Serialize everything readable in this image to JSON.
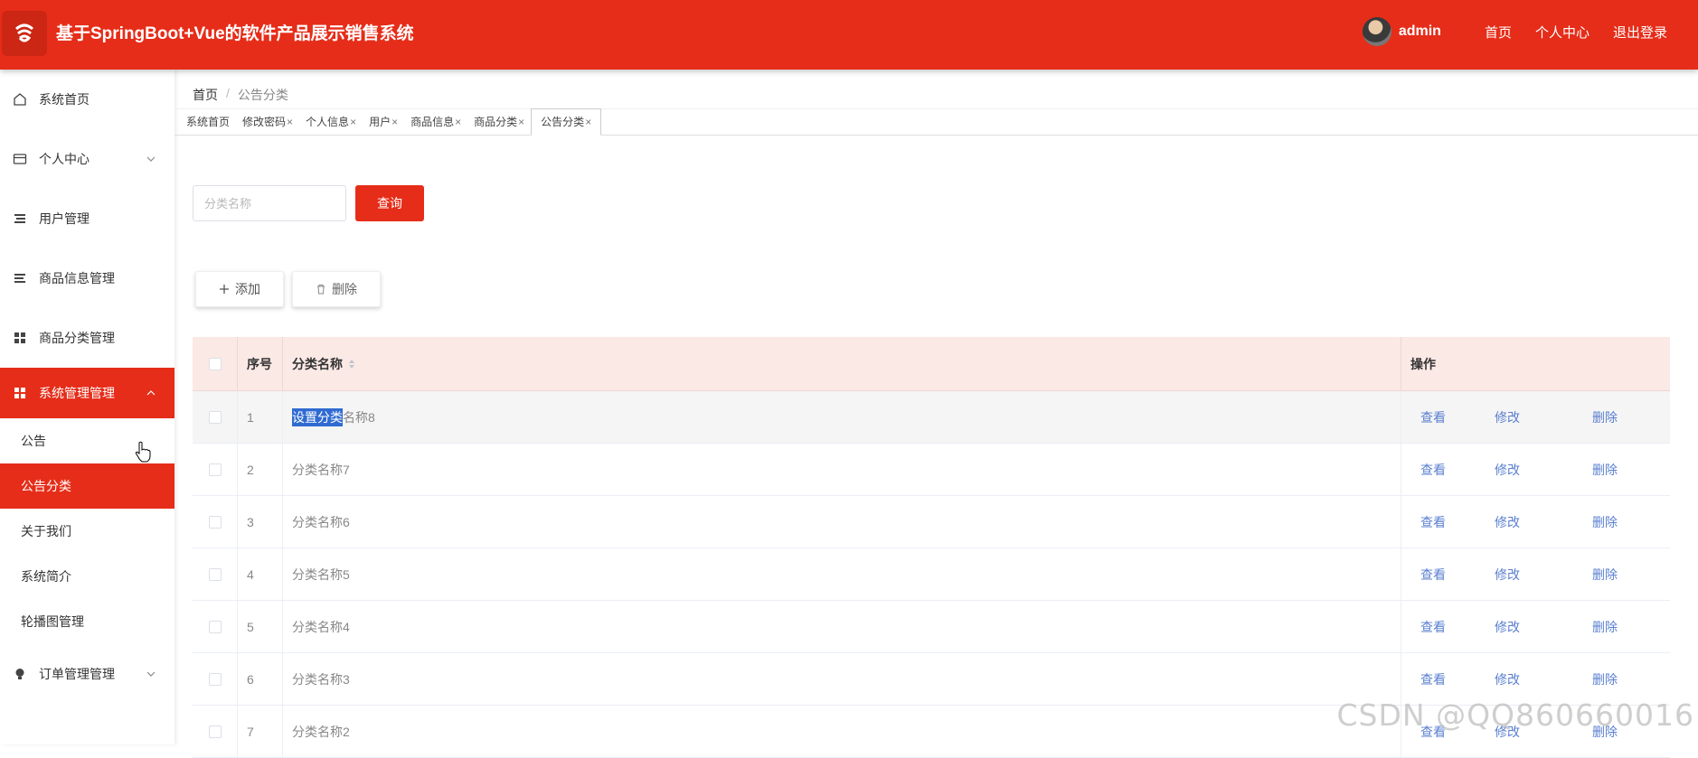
{
  "header": {
    "title": "基于SpringBoot+Vue的软件产品展示销售系统",
    "username": "admin",
    "links": [
      "首页",
      "个人中心",
      "退出登录"
    ]
  },
  "sidebar": {
    "items": [
      {
        "label": "系统首页",
        "icon": "home-icon"
      },
      {
        "label": "个人中心",
        "icon": "card-icon"
      },
      {
        "label": "用户管理",
        "icon": "list-icon"
      },
      {
        "label": "商品信息管理",
        "icon": "list-icon"
      },
      {
        "label": "商品分类管理",
        "icon": "grid-icon"
      },
      {
        "label": "系统管理管理",
        "icon": "grid-icon"
      },
      {
        "label": "订单管理管理",
        "icon": "bulb-icon"
      }
    ],
    "sub_items": [
      "公告",
      "公告分类",
      "关于我们",
      "系统简介",
      "轮播图管理"
    ]
  },
  "breadcrumb": {
    "home": "首页",
    "separator": "/",
    "current": "公告分类"
  },
  "tabs": [
    "系统首页",
    "修改密码",
    "个人信息",
    "用户",
    "商品信息",
    "商品分类",
    "公告分类"
  ],
  "tab_close": "×",
  "search": {
    "placeholder": "分类名称",
    "query_label": "查询"
  },
  "actions": {
    "add_label": "添加",
    "delete_label": "删除"
  },
  "table": {
    "columns": [
      "序号",
      "分类名称",
      "操作"
    ],
    "ops": [
      "查看",
      "修改",
      "删除"
    ],
    "first_row_selected": "设置分类",
    "first_row_rest": "名称8",
    "rows": [
      {
        "idx": "1",
        "name": "设置分类名称8"
      },
      {
        "idx": "2",
        "name": "分类名称7"
      },
      {
        "idx": "3",
        "name": "分类名称6"
      },
      {
        "idx": "4",
        "name": "分类名称5"
      },
      {
        "idx": "5",
        "name": "分类名称4"
      },
      {
        "idx": "6",
        "name": "分类名称3"
      },
      {
        "idx": "7",
        "name": "分类名称2"
      }
    ]
  },
  "watermark": "CSDN @QQ860660016",
  "colors": {
    "primary": "#e62d19",
    "link": "#5a7fd0",
    "table_head": "#fbe9e6"
  }
}
